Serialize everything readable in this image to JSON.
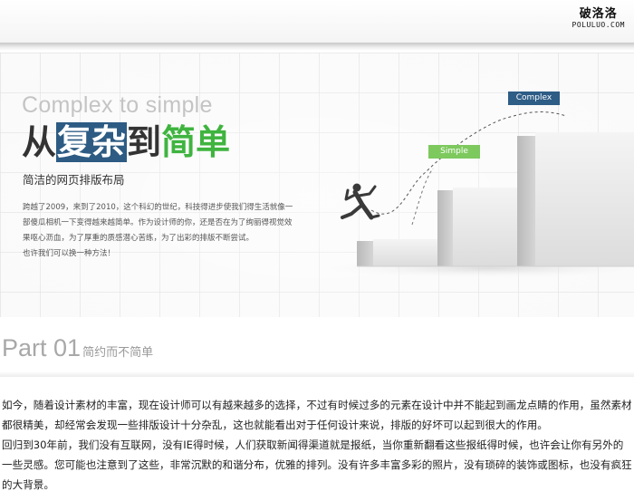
{
  "brand": {
    "name_cn": "破洛洛",
    "name_en": "POLULUO.COM"
  },
  "banner": {
    "heading_en": "Complex to simple",
    "title": {
      "part1": "从",
      "part2": "复杂",
      "part3": "到",
      "part4": "简单"
    },
    "subtitle": "简洁的网页排版布局",
    "paragraph": [
      "跨越了2009，来到了2010，这个科幻的世纪，科技得进步使我们得生活就像一",
      "部傻瓜相机一下变得越来越简单。作为设计师的你，还是否在为了绚丽得视觉效",
      "果呕心沥血，为了厚重的质感潜心苦练，为了出彩的排版不断尝试。",
      "也许我们可以换一种方法！"
    ],
    "tags": {
      "complex": "Complex",
      "simple": "Simple"
    },
    "colors": {
      "complex_tag": "#2e5d86",
      "simple_tag": "#7dc95e",
      "highlight": "#2d5b83",
      "green": "#3fb43f"
    }
  },
  "section": {
    "part_label": "Part 01",
    "part_subtitle": "简约而不简单",
    "paragraphs": [
      "如今，随着设计素材的丰富，现在设计师可以有越来越多的选择，不过有时候过多的元素在设计中并不能起到画龙点睛的作用，虽然素材都很精美，却经常会发现一些排版设计十分杂乱，这也就能看出对于任何设计来说，排版的好坏可以起到很大的作用。",
      "回归到30年前，我们没有互联网，没有IE得时候，人们获取新闻得渠道就是报纸，当你重新翻看这些报纸得时候，也许会让你有另外的一些灵感。您可能也注意到了这些，非常沉默的和谐分布，优雅的排列。没有许多丰富多彩的照片，没有琐碎的装饰或图标，也没有疯狂的大背景。"
    ]
  }
}
